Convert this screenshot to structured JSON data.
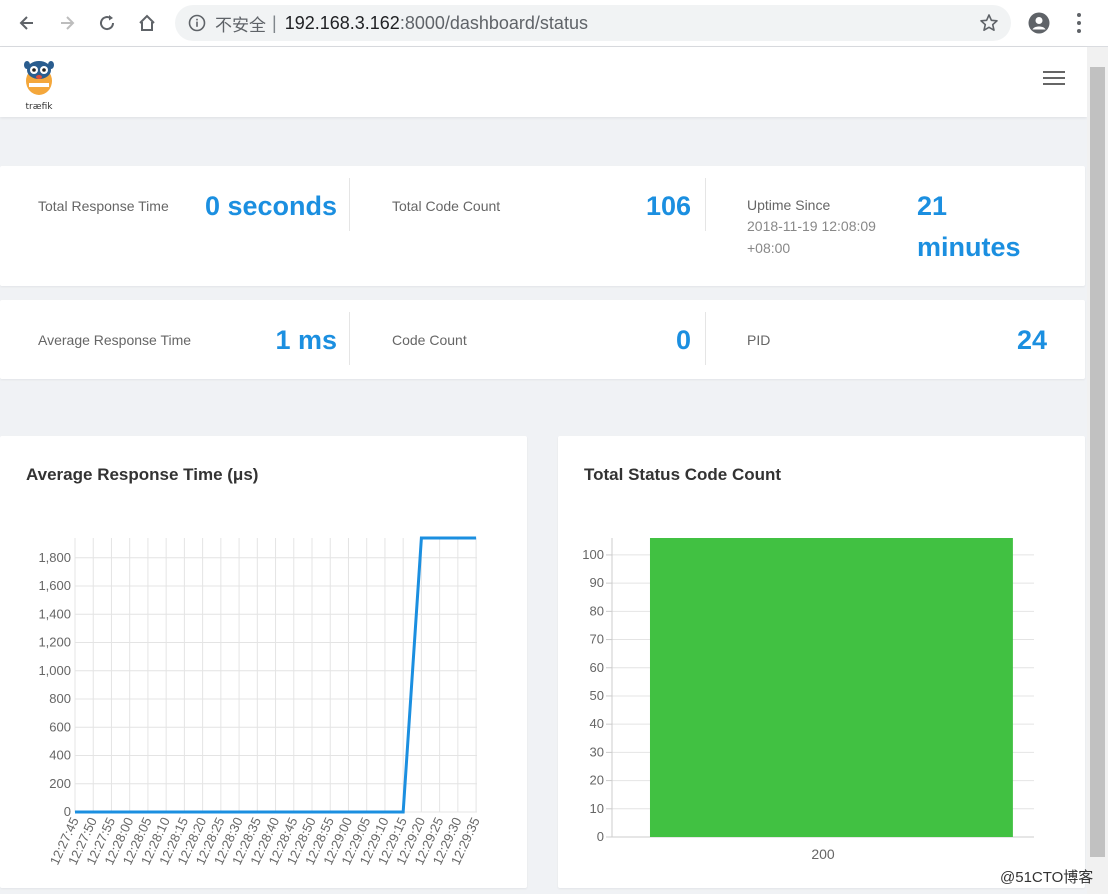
{
  "browser": {
    "security_label": "不安全",
    "url_host": "192.168.3.162",
    "url_rest": ":8000/dashboard/status"
  },
  "app": {
    "logo_text": "træfik"
  },
  "stats_top": {
    "total_response_time_label": "Total Response Time",
    "total_response_time_value": "0 seconds",
    "total_code_count_label": "Total Code Count",
    "total_code_count_value": "106",
    "uptime_label": "Uptime Since",
    "uptime_date": "2018-11-19 12:08:09",
    "uptime_tz": "+08:00",
    "uptime_value_line1": "21",
    "uptime_value_line2": "minutes"
  },
  "stats_bottom": {
    "avg_response_time_label": "Average Response Time",
    "avg_response_time_value": "1 ms",
    "code_count_label": "Code Count",
    "code_count_value": "0",
    "pid_label": "PID",
    "pid_value": "24"
  },
  "chart_data": [
    {
      "type": "line",
      "title": "Average Response Time (μs)",
      "x": [
        "12:27:45",
        "12:27:50",
        "12:27:55",
        "12:28:00",
        "12:28:05",
        "12:28:10",
        "12:28:15",
        "12:28:20",
        "12:28:25",
        "12:28:30",
        "12:28:35",
        "12:28:40",
        "12:28:45",
        "12:28:50",
        "12:28:55",
        "12:29:00",
        "12:29:05",
        "12:29:10",
        "12:29:15",
        "12:29:20",
        "12:29:25",
        "12:29:30",
        "12:29:35"
      ],
      "values": [
        0,
        0,
        0,
        0,
        0,
        0,
        0,
        0,
        0,
        0,
        0,
        0,
        0,
        0,
        0,
        0,
        0,
        0,
        0,
        1940,
        1940,
        1940,
        1940
      ],
      "yticks": [
        "0",
        "200",
        "400",
        "600",
        "800",
        "1,000",
        "1,200",
        "1,400",
        "1,600",
        "1,800"
      ],
      "ylim": [
        0,
        1940
      ],
      "color": "#1b8fe0",
      "grid": true
    },
    {
      "type": "bar",
      "title": "Total Status Code Count",
      "categories": [
        "200"
      ],
      "values": [
        106
      ],
      "yticks": [
        "0",
        "10",
        "20",
        "30",
        "40",
        "50",
        "60",
        "70",
        "80",
        "90",
        "100"
      ],
      "ylim": [
        0,
        106
      ],
      "color": "#41c142",
      "grid": true
    }
  ],
  "watermark": "@51CTO博客"
}
